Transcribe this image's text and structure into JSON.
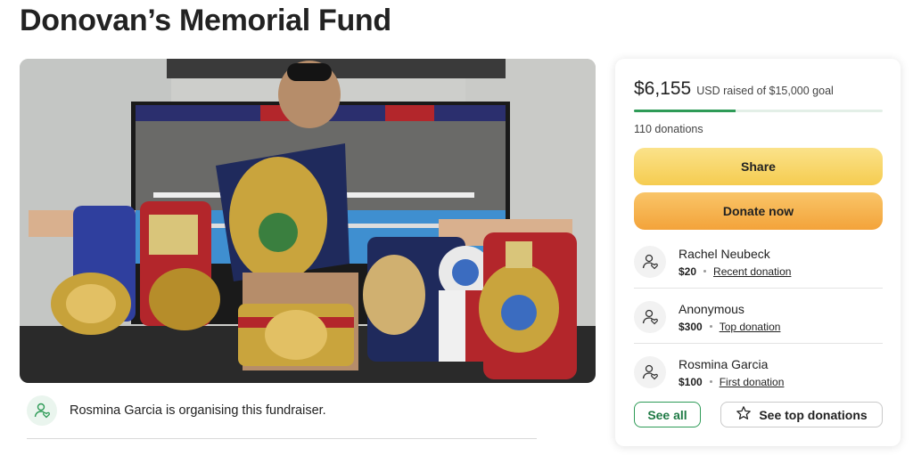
{
  "page": {
    "title": "Donovan’s Memorial Fund",
    "hero_image": "boxer-with-championship-belts"
  },
  "organizer": {
    "icon": "user-heart-icon",
    "text": "Rosmina Garcia is organising this fundraiser."
  },
  "fundraiser": {
    "amount": "$6,155",
    "raised_text": "USD raised of $15,000 goal",
    "progress_fraction": 0.41,
    "donations_count": "110 donations",
    "share_label": "Share",
    "donate_label": "Donate now",
    "donors": [
      {
        "name": "Rachel Neubeck",
        "amount": "$20",
        "tag": "Recent donation",
        "icon": "user-heart-icon"
      },
      {
        "name": "Anonymous",
        "amount": "$300",
        "tag": "Top donation",
        "icon": "user-heart-icon"
      },
      {
        "name": "Rosmina Garcia",
        "amount": "$100",
        "tag": "First donation",
        "icon": "user-heart-icon"
      }
    ],
    "see_all_label": "See all",
    "see_top_label": "See top donations",
    "star_icon": "star-icon"
  },
  "colors": {
    "accent_green": "#2e9b57",
    "share_yellow": "#f5cc50",
    "donate_orange": "#f3a33a"
  }
}
